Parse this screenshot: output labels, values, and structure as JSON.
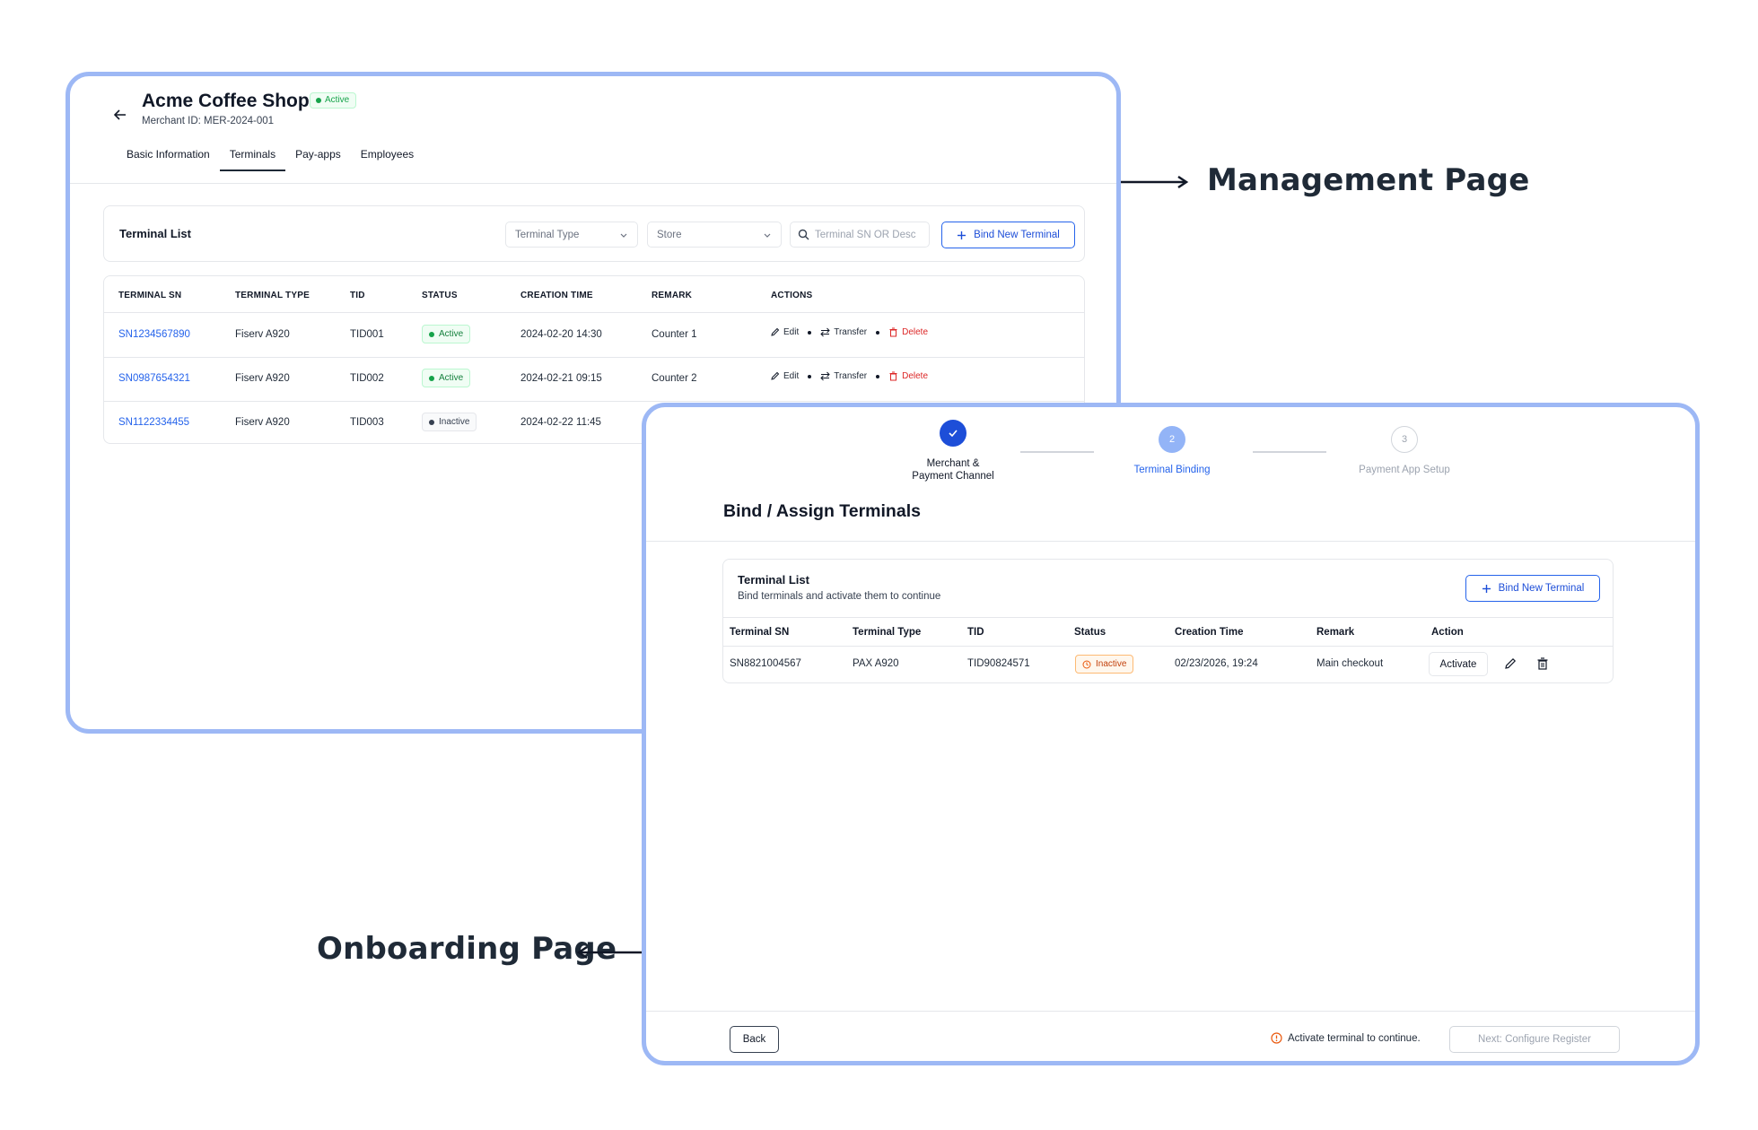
{
  "callouts": {
    "management": "Management Page",
    "onboarding": "Onboarding Page"
  },
  "management": {
    "merchant_name": "Acme Coffee Shop",
    "status_badge": "Active",
    "merchant_id": "Merchant ID: MER-2024-001",
    "tabs": [
      {
        "label": "Basic Information"
      },
      {
        "label": "Terminals"
      },
      {
        "label": "Pay-apps"
      },
      {
        "label": "Employees"
      }
    ],
    "active_tab": "Terminals",
    "toolbar": {
      "title": "Terminal List",
      "terminal_type_select": "Terminal Type",
      "store_select": "Store",
      "search_placeholder": "Terminal SN OR Desc",
      "bind_button": "Bind New Terminal"
    },
    "table": {
      "headers": [
        "TERMINAL SN",
        "TERMINAL TYPE",
        "TID",
        "STATUS",
        "CREATION TIME",
        "REMARK",
        "ACTIONS"
      ],
      "rows": [
        {
          "sn": "SN1234567890",
          "type": "Fiserv A920",
          "tid": "TID001",
          "status": "Active",
          "created": "2024-02-20 14:30",
          "remark": "Counter 1"
        },
        {
          "sn": "SN0987654321",
          "type": "Fiserv A920",
          "tid": "TID002",
          "status": "Active",
          "created": "2024-02-21 09:15",
          "remark": "Counter 2"
        },
        {
          "sn": "SN1122334455",
          "type": "Fiserv A920",
          "tid": "TID003",
          "status": "Inactive",
          "created": "2024-02-22 11:45",
          "remark": ""
        }
      ],
      "actions": {
        "edit": "Edit",
        "transfer": "Transfer",
        "delete": "Delete"
      }
    },
    "colors": {
      "active": "#16a34a",
      "inactive": "#374151",
      "link": "#2563eb",
      "delete": "#dc2626"
    }
  },
  "onboarding": {
    "steps": [
      {
        "label": "Merchant &\nPayment Channel",
        "state": "complete",
        "number": "1"
      },
      {
        "label": "Terminal Binding",
        "state": "current",
        "number": "2"
      },
      {
        "label": "Payment App Setup",
        "state": "upcoming",
        "number": "3"
      }
    ],
    "title": "Bind / Assign Terminals",
    "card": {
      "title": "Terminal List",
      "subtitle": "Bind terminals and activate them to continue",
      "bind_button": "Bind New Terminal",
      "headers": [
        "Terminal SN",
        "Terminal Type",
        "TID",
        "Status",
        "Creation Time",
        "Remark",
        "Action"
      ],
      "row": {
        "sn": "SN8821004567",
        "type": "PAX A920",
        "tid": "TID90824571",
        "status": "Inactive",
        "created": "02/23/2026, 19:24",
        "remark": "Main checkout",
        "activate_button": "Activate"
      }
    },
    "footer": {
      "back_button": "Back",
      "warning": "Activate terminal to continue.",
      "next_button": "Next: Configure Register"
    },
    "colors": {
      "primary": "#1d4ed8",
      "step_current": "#93b4f7",
      "warning": "#ea580c",
      "frame": "#9db8f5"
    }
  }
}
